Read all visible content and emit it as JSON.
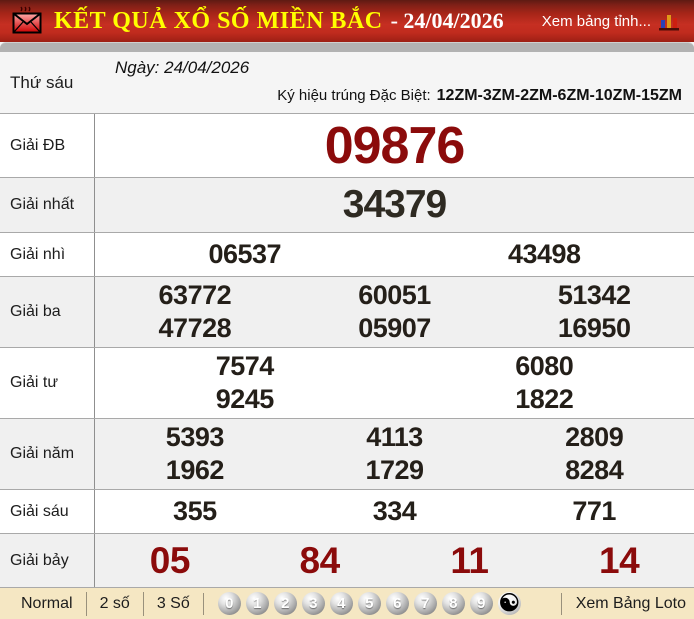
{
  "header": {
    "title": "KẾT QUẢ XỔ SỐ MIỀN BẮC",
    "date_suffix": "- 24/04/2026",
    "right_link": "Xem bảng tỉnh..."
  },
  "info": {
    "weekday": "Thứ sáu",
    "date_line": "Ngày: 24/04/2026",
    "symbol_label": "Ký hiệu trúng Đặc Biệt:",
    "symbol_value": "12ZM-3ZM-2ZM-6ZM-10ZM-15ZM"
  },
  "results": {
    "rows": [
      {
        "label": "Giải ĐB",
        "style": "special",
        "lines": [
          [
            "09876"
          ]
        ]
      },
      {
        "label": "Giải nhất",
        "style": "first",
        "lines": [
          [
            "34379"
          ]
        ]
      },
      {
        "label": "Giải nhì",
        "lines": [
          [
            "06537",
            "43498"
          ]
        ]
      },
      {
        "label": "Giải ba",
        "lines": [
          [
            "63772",
            "60051",
            "51342"
          ],
          [
            "47728",
            "05907",
            "16950"
          ]
        ]
      },
      {
        "label": "Giải tư",
        "lines": [
          [
            "7574",
            "6080"
          ],
          [
            "9245",
            "1822"
          ]
        ]
      },
      {
        "label": "Giải năm",
        "lines": [
          [
            "5393",
            "4113",
            "2809"
          ],
          [
            "1962",
            "1729",
            "8284"
          ]
        ]
      },
      {
        "label": "Giải sáu",
        "lines": [
          [
            "355",
            "334",
            "771"
          ]
        ]
      },
      {
        "label": "Giải bảy",
        "style": "seventh",
        "lines": [
          [
            "05",
            "84",
            "11",
            "14"
          ]
        ]
      }
    ]
  },
  "footer": {
    "modes": [
      "Normal",
      "2 số",
      "3 Số"
    ],
    "balls": [
      "0",
      "1",
      "2",
      "3",
      "4",
      "5",
      "6",
      "7",
      "8",
      "9"
    ],
    "yin_yang": "☯",
    "loto_link": "Xem Bảng Loto"
  },
  "colors": {
    "header_red": "#c62f22",
    "title_yellow": "#ffff00",
    "number_red": "#8b0b0b",
    "footer_bg": "#f5e7c3"
  }
}
